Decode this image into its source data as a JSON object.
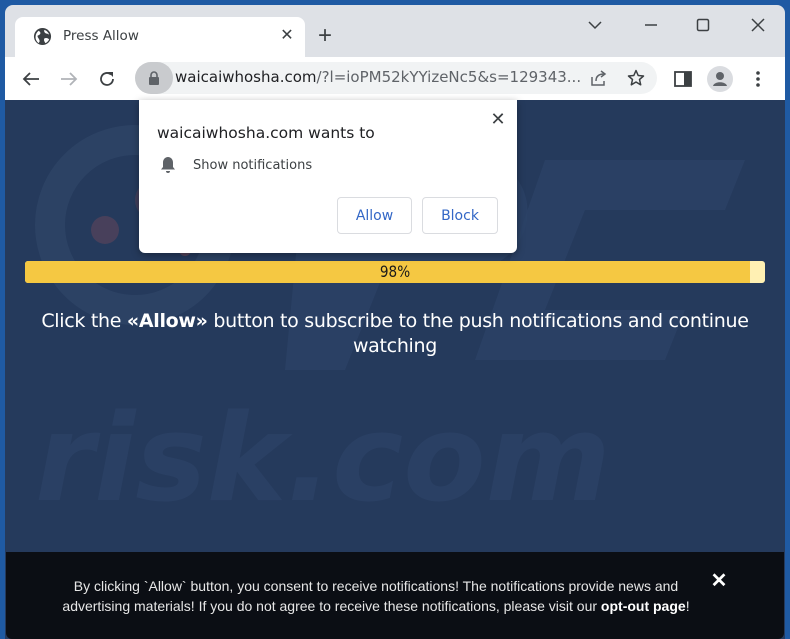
{
  "browser": {
    "tab": {
      "title": "Press Allow",
      "icon": "globe-icon"
    },
    "new_tab_label": "+",
    "window_controls": [
      "tab-search",
      "minimize",
      "maximize",
      "close"
    ],
    "address": {
      "domain": "waicaiwhosha.com",
      "path": "/?l=ioPM52kYYizeNc5&s=129343..."
    }
  },
  "permission_popup": {
    "title": "waicaiwhosha.com wants to",
    "permission": "Show notifications",
    "allow_label": "Allow",
    "block_label": "Block",
    "close_label": "✕"
  },
  "page": {
    "progress": {
      "value_percent": 98,
      "label": "98%"
    },
    "headline": {
      "before": "Click the ",
      "bold": "«Allow»",
      "after": " button to subscribe to the push notifications and continue watching"
    },
    "watermark": "PC risk.com",
    "footer": {
      "text_before": "By clicking `Allow` button, you consent to receive notifications! The notifications provide news and advertising materials! If you do not agree to receive these notifications, please visit our ",
      "link": "opt-out page",
      "text_after": "!",
      "close_label": "✕"
    }
  },
  "colors": {
    "page_bg": "#253a5c",
    "progress_fill": "#f5c842",
    "progress_track": "#fff0b3",
    "footer_bg": "#0b0e14",
    "popup_button_text": "#3367c6"
  }
}
